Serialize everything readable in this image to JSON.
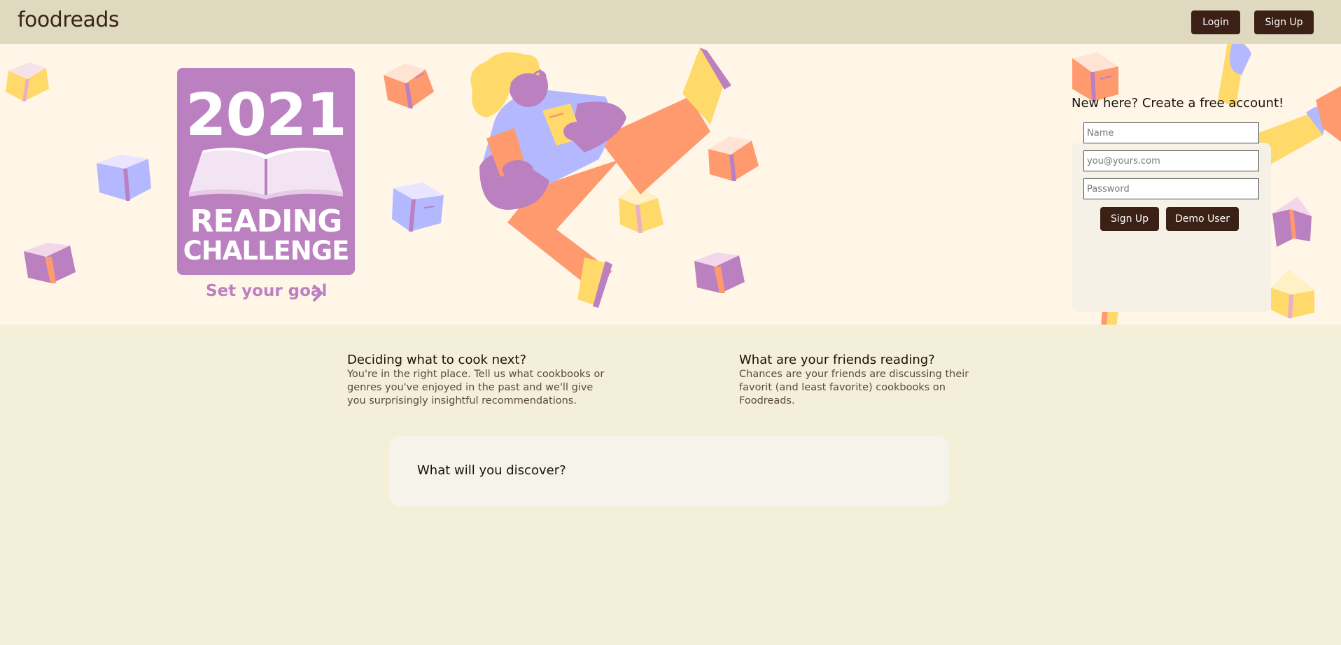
{
  "nav": {
    "logo": "foodreads",
    "login_label": "Login",
    "signup_label": "Sign Up"
  },
  "hero": {
    "badge_year": "2021",
    "badge_line1": "READING",
    "badge_line2": "CHALLENGE",
    "goal_link": "Set your goal",
    "goal_icon": "chevron-right-icon"
  },
  "signup": {
    "title": "New here? Create a free account!",
    "name_placeholder": "Name",
    "email_placeholder": "you@yours.com",
    "password_placeholder": "Password",
    "signup_button": "Sign Up",
    "demo_button": "Demo User"
  },
  "features": [
    {
      "title": "Deciding what to cook next?",
      "text": "You're in the right place. Tell us what cookbooks or genres you've enjoyed in the past and we'll give you surprisingly insightful recommendations."
    },
    {
      "title": "What are your friends reading?",
      "text": "Chances are your friends are discussing their favorit (and least favorite) cookbooks on Foodreads."
    }
  ],
  "discover": {
    "title": "What will you discover?"
  },
  "colors": {
    "nav_bg": "#dfd9bf",
    "hero_bg": "#fff6e8",
    "page_bg": "#f4efd9",
    "button_bg": "#3b2015",
    "badge_purple": "#bb80c0",
    "book_yellow": "#ffd96a",
    "book_orange": "#ff9a6e",
    "book_blue": "#b3b8ff",
    "book_purple": "#bb80c0"
  }
}
